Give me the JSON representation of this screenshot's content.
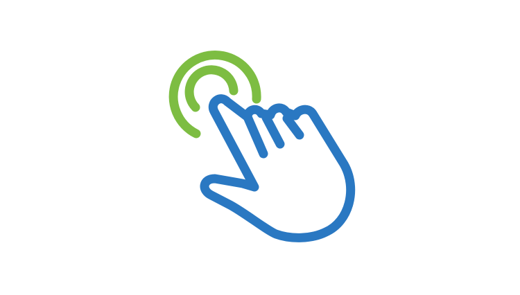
{
  "icon": {
    "name": "tap-gesture-icon",
    "parts": [
      "touch-ripple-icon",
      "pointing-hand-icon"
    ]
  },
  "colors": {
    "background": "#ffffff",
    "ripple": "#7dbd42",
    "hand": "#2a78c2"
  }
}
